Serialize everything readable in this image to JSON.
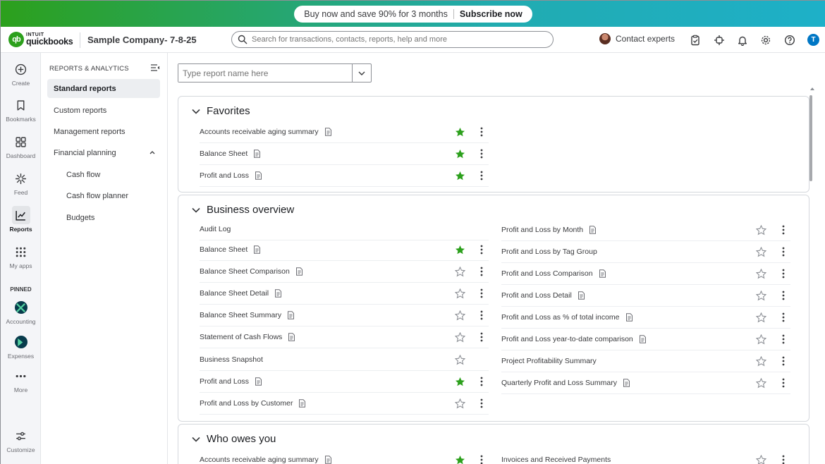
{
  "promo": {
    "text": "Buy now and save 90% for 3 months",
    "cta": "Subscribe now"
  },
  "header": {
    "logo_intuit": "INTUIT",
    "logo_qb": "quickbooks",
    "logo_mark": "qb",
    "company": "Sample Company- 7-8-25",
    "search_placeholder": "Search for transactions, contacts, reports, help and more",
    "contact_experts": "Contact experts",
    "user_initial": "T"
  },
  "rail": {
    "create": "Create",
    "bookmarks": "Bookmarks",
    "dashboard": "Dashboard",
    "feed": "Feed",
    "reports": "Reports",
    "my_apps": "My apps",
    "pinned": "PINNED",
    "accounting": "Accounting",
    "expenses": "Expenses",
    "more": "More",
    "customize": "Customize"
  },
  "subnav": {
    "heading": "REPORTS & ANALYTICS",
    "items": [
      "Standard reports",
      "Custom reports",
      "Management reports",
      "Financial planning"
    ],
    "sub_items": [
      "Cash flow",
      "Cash flow planner",
      "Budgets"
    ]
  },
  "main": {
    "report_search_placeholder": "Type report name here",
    "favorites": {
      "title": "Favorites",
      "rows": [
        {
          "name": "Accounts receivable aging summary",
          "starred": true
        },
        {
          "name": "Balance Sheet",
          "starred": true
        },
        {
          "name": "Profit and Loss",
          "starred": true
        }
      ]
    },
    "business_overview": {
      "title": "Business overview",
      "left": [
        {
          "name": "Audit Log",
          "doc": false,
          "star": false,
          "kebab": false
        },
        {
          "name": "Balance Sheet",
          "doc": true,
          "starred": true
        },
        {
          "name": "Balance Sheet Comparison",
          "doc": true,
          "starred": false
        },
        {
          "name": "Balance Sheet Detail",
          "doc": true,
          "starred": false
        },
        {
          "name": "Balance Sheet Summary",
          "doc": true,
          "starred": false
        },
        {
          "name": "Statement of Cash Flows",
          "doc": true,
          "starred": false
        },
        {
          "name": "Business Snapshot",
          "doc": false,
          "starred": false,
          "kebab": false
        },
        {
          "name": "Profit and Loss",
          "doc": true,
          "starred": true
        },
        {
          "name": "Profit and Loss by Customer",
          "doc": true,
          "starred": false
        }
      ],
      "right": [
        {
          "name": "Profit and Loss by Month",
          "doc": true,
          "starred": false
        },
        {
          "name": "Profit and Loss by Tag Group",
          "doc": false,
          "starred": false
        },
        {
          "name": "Profit and Loss Comparison",
          "doc": true,
          "starred": false
        },
        {
          "name": "Profit and Loss Detail",
          "doc": true,
          "starred": false
        },
        {
          "name": "Profit and Loss as % of total income",
          "doc": true,
          "starred": false
        },
        {
          "name": "Profit and Loss year-to-date comparison",
          "doc": true,
          "starred": false
        },
        {
          "name": "Project Profitability Summary",
          "doc": false,
          "starred": false
        },
        {
          "name": "Quarterly Profit and Loss Summary",
          "doc": true,
          "starred": false
        }
      ]
    },
    "who_owes_you": {
      "title": "Who owes you",
      "left": [
        {
          "name": "Accounts receivable aging summary",
          "doc": true,
          "starred": true
        }
      ],
      "right": [
        {
          "name": "Invoices and Received Payments",
          "doc": false,
          "starred": false
        }
      ]
    }
  },
  "colors": {
    "brand_green": "#2ca01c",
    "star_green": "#2ca01c",
    "star_empty": "#8d9096",
    "accent_blue": "#0077c5"
  }
}
